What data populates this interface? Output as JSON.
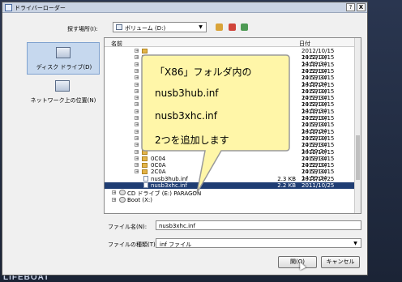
{
  "desktop": {
    "brand": "LIFEBOAT"
  },
  "dialog": {
    "title": "ドライバーローダー",
    "help": "?",
    "close": "X"
  },
  "lookin": {
    "label": "探す場所(I):",
    "value": "ボリューム (D:)"
  },
  "places": [
    {
      "label": "ディスク ドライブ(D)",
      "icon": "disk-drive-icon"
    },
    {
      "label": "ネットワーク上の位置(N)",
      "icon": "network-icon"
    }
  ],
  "filelist": {
    "columns": {
      "name": "名前",
      "date": "日付"
    },
    "rows": [
      {
        "name": "",
        "size": "",
        "date": "2012/10/15 14:59:34",
        "kind": "folder"
      },
      {
        "name": "",
        "size": "",
        "date": "2012/10/15 14:59:34",
        "kind": "folder"
      },
      {
        "name": "",
        "size": "",
        "date": "2012/10/15 14:59:34",
        "kind": "folder"
      },
      {
        "name": "",
        "size": "",
        "date": "2012/10/15 14:59:34",
        "kind": "folder"
      },
      {
        "name": "",
        "size": "",
        "date": "2012/10/15 14:59:34",
        "kind": "folder"
      },
      {
        "name": "",
        "size": "",
        "date": "2012/10/15 14:59:34",
        "kind": "folder"
      },
      {
        "name": "",
        "size": "",
        "date": "2012/10/15 14:59:34",
        "kind": "folder"
      },
      {
        "name": "",
        "size": "",
        "date": "2012/10/15 14:59:34",
        "kind": "folder"
      },
      {
        "name": "",
        "size": "",
        "date": "2012/10/15 14:59:34",
        "kind": "folder"
      },
      {
        "name": "",
        "size": "",
        "date": "2012/10/15 14:59:34",
        "kind": "folder"
      },
      {
        "name": "",
        "size": "",
        "date": "2012/10/15 14:59:34",
        "kind": "folder"
      },
      {
        "name": "",
        "size": "",
        "date": "2012/10/15 14:59:34",
        "kind": "folder"
      },
      {
        "name": "",
        "size": "",
        "date": "2012/10/15 14:59:34",
        "kind": "folder"
      },
      {
        "name": "",
        "size": "",
        "date": "2012/10/15 14:59:34",
        "kind": "folder"
      },
      {
        "name": "",
        "size": "",
        "date": "2012/10/15 14:59:34",
        "kind": "folder"
      },
      {
        "name": "",
        "size": "",
        "date": "2012/10/15 14:59:34",
        "kind": "folder"
      },
      {
        "name": "0C04",
        "size": "",
        "date": "2012/10/15 14:59:34",
        "kind": "folder"
      },
      {
        "name": "0C0A",
        "size": "",
        "date": "2012/10/15 14:59:34",
        "kind": "folder"
      },
      {
        "name": "2C0A",
        "size": "",
        "date": "2012/10/15 14:59:34",
        "kind": "folder"
      },
      {
        "name": "nusb3hub.inf",
        "size": "2.3 KB",
        "date": "2011/10/25 9:51:10",
        "kind": "file"
      },
      {
        "name": "nusb3xhc.inf",
        "size": "2.2 KB",
        "date": "2011/10/25 9:51:10",
        "kind": "file",
        "selected": true
      }
    ],
    "tree": [
      {
        "name": "CD ドライブ (E:) PARAGON"
      },
      {
        "name": "Boot (X:)"
      }
    ]
  },
  "filename": {
    "label": "ファイル名(N):",
    "value": "nusb3xhc.inf"
  },
  "filetype": {
    "label": "ファイルの種類(T):",
    "value": "inf ファイル"
  },
  "buttons": {
    "open": "開(O)",
    "cancel": "キャンセル"
  },
  "callout": {
    "lines": [
      "「X86」フォルダ内の",
      "nusb3hub.inf",
      "nusb3xhc.inf",
      "2つを追加します"
    ],
    "fill": "#fff6a8",
    "stroke": "#9a9a9a"
  }
}
